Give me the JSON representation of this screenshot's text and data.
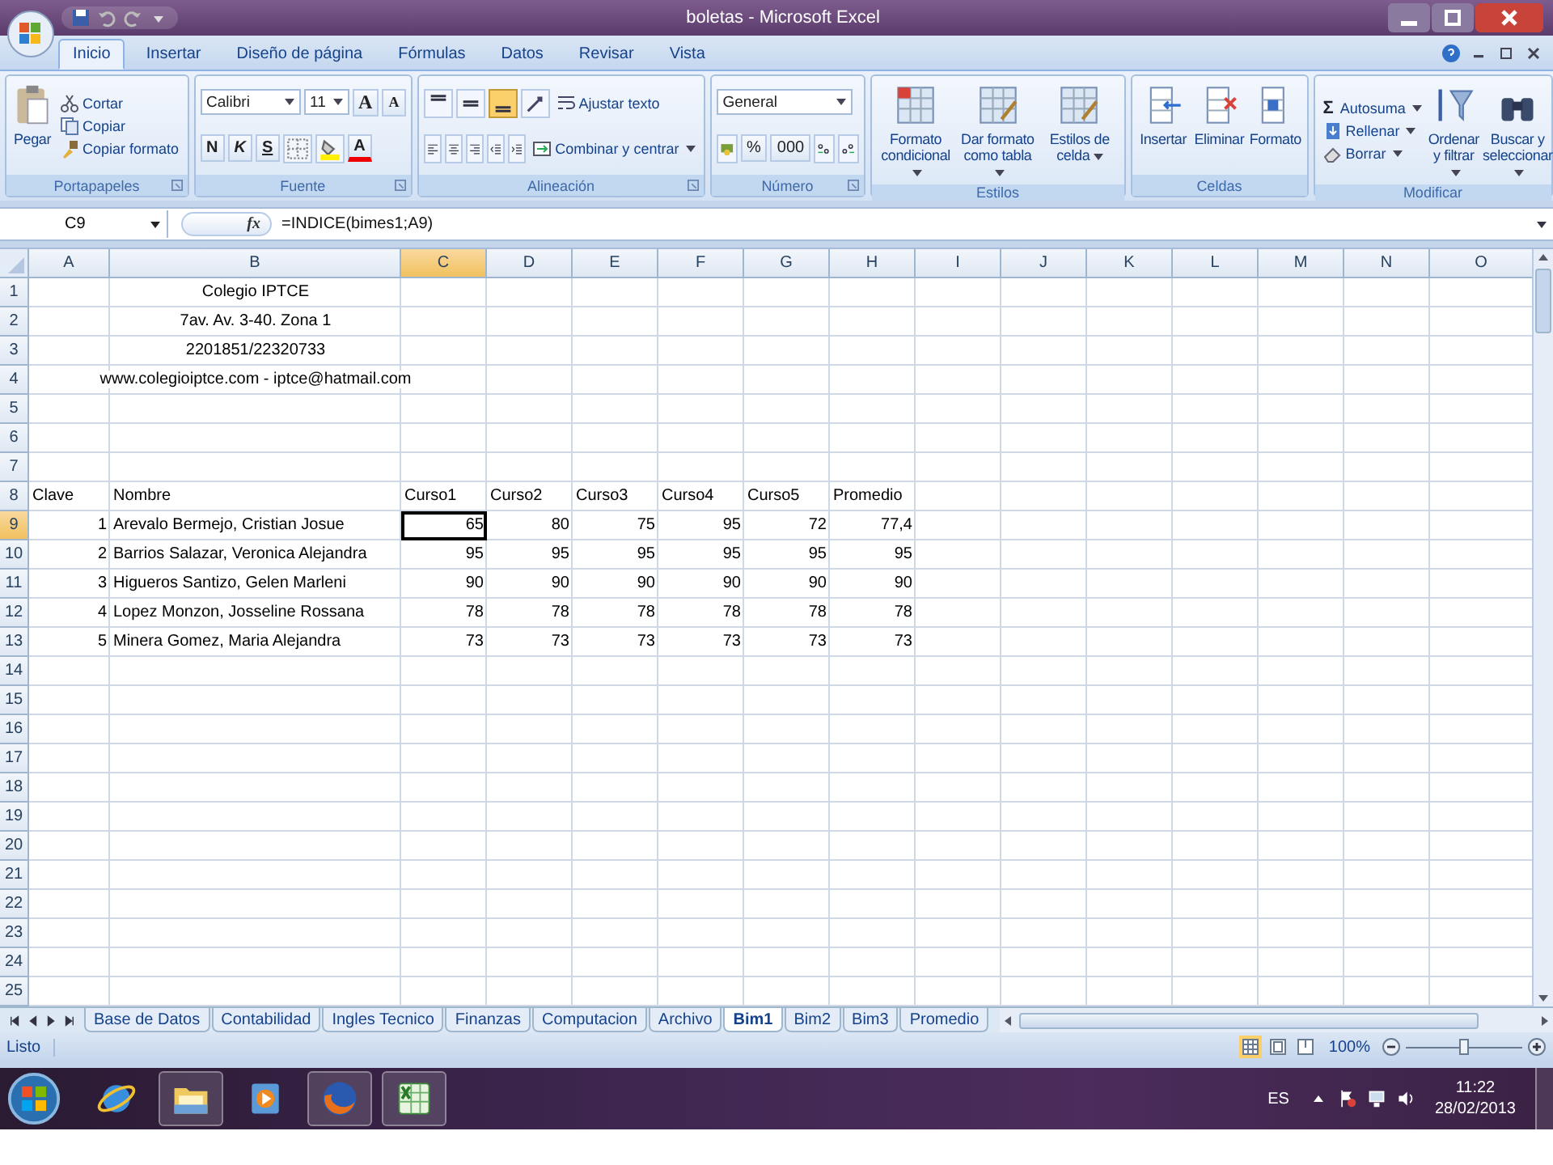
{
  "window": {
    "title": "boletas - Microsoft Excel"
  },
  "ribbon_tabs": [
    {
      "label": "Inicio",
      "selected": true
    },
    {
      "label": "Insertar",
      "selected": false
    },
    {
      "label": "Diseño de página",
      "selected": false
    },
    {
      "label": "Fórmulas",
      "selected": false
    },
    {
      "label": "Datos",
      "selected": false
    },
    {
      "label": "Revisar",
      "selected": false
    },
    {
      "label": "Vista",
      "selected": false
    }
  ],
  "clipboard": {
    "label": "Portapapeles",
    "paste": "Pegar",
    "cut": "Cortar",
    "copy": "Copiar",
    "format_painter": "Copiar formato"
  },
  "font": {
    "label": "Fuente",
    "name": "Calibri",
    "size": "11",
    "grow": "A",
    "shrink": "A",
    "bold": "N",
    "italic": "K",
    "underline": "S",
    "tint_glyph": "A"
  },
  "alignment": {
    "label": "Alineación",
    "vertical_align": [
      {
        "selected": false
      },
      {
        "selected": false
      },
      {
        "selected": true
      }
    ],
    "wrap": "Ajustar texto",
    "merge": "Combinar y centrar"
  },
  "number": {
    "label": "Número",
    "format": "General",
    "percent": "%",
    "thousands": "000"
  },
  "styles": {
    "label": "Estilos",
    "items": [
      "Formato condicional",
      "Dar formato como tabla",
      "Estilos de celda"
    ]
  },
  "cells": {
    "label": "Celdas",
    "items": [
      "Insertar",
      "Eliminar",
      "Formato"
    ]
  },
  "editing": {
    "label": "Modificar",
    "sigma": "Σ",
    "autosum": "Autosuma",
    "fill": "Rellenar",
    "clear": "Borrar",
    "sort": "Ordenar y filtrar",
    "find": "Buscar y seleccionar"
  },
  "formula_bar": {
    "name_box": "C9",
    "fx": "fx",
    "formula": "=INDICE(bimes1;A9)"
  },
  "sheet": {
    "columns": [
      {
        "label": "A",
        "selected": false
      },
      {
        "label": "B",
        "selected": false
      },
      {
        "label": "C",
        "selected": true
      },
      {
        "label": "D",
        "selected": false
      },
      {
        "label": "E",
        "selected": false
      },
      {
        "label": "F",
        "selected": false
      },
      {
        "label": "G",
        "selected": false
      },
      {
        "label": "H",
        "selected": false
      },
      {
        "label": "I",
        "selected": false
      },
      {
        "label": "J",
        "selected": false
      },
      {
        "label": "K",
        "selected": false
      },
      {
        "label": "L",
        "selected": false
      },
      {
        "label": "M",
        "selected": false
      },
      {
        "label": "N",
        "selected": false
      },
      {
        "label": "O",
        "selected": false
      }
    ],
    "rows": [
      {
        "header": "1",
        "selected": false,
        "kind": "title",
        "title": "Colegio IPTCE"
      },
      {
        "header": "2",
        "selected": false,
        "kind": "title",
        "title": "7av. Av. 3-40. Zona 1"
      },
      {
        "header": "3",
        "selected": false,
        "kind": "title",
        "title": "2201851/22320733"
      },
      {
        "header": "4",
        "selected": false,
        "kind": "title",
        "title": "www.colegioiptce.com - iptce@hatmail.com"
      },
      {
        "header": "5",
        "selected": false
      },
      {
        "header": "6",
        "selected": false
      },
      {
        "header": "7",
        "selected": false
      },
      {
        "header": "8",
        "selected": false,
        "kind": "heading",
        "cells": [
          "Clave",
          "Nombre",
          "Curso1",
          "Curso2",
          "Curso3",
          "Curso4",
          "Curso5",
          "Promedio"
        ]
      },
      {
        "header": "9",
        "selected": true,
        "kind": "record",
        "cells": [
          "1",
          "Arevalo Bermejo, Cristian Josue",
          "65",
          "80",
          "75",
          "95",
          "72",
          "77,4"
        ]
      },
      {
        "header": "10",
        "selected": false,
        "kind": "record",
        "cells": [
          "2",
          "Barrios Salazar, Veronica Alejandra",
          "95",
          "95",
          "95",
          "95",
          "95",
          "95"
        ]
      },
      {
        "header": "11",
        "selected": false,
        "kind": "record",
        "cells": [
          "3",
          "Higueros Santizo, Gelen Marleni",
          "90",
          "90",
          "90",
          "90",
          "90",
          "90"
        ]
      },
      {
        "header": "12",
        "selected": false,
        "kind": "record",
        "cells": [
          "4",
          "Lopez Monzon, Josseline Rossana",
          "78",
          "78",
          "78",
          "78",
          "78",
          "78"
        ]
      },
      {
        "header": "13",
        "selected": false,
        "kind": "record",
        "cells": [
          "5",
          "Minera Gomez, Maria Alejandra",
          "73",
          "73",
          "73",
          "73",
          "73",
          "73"
        ]
      },
      {
        "header": "14",
        "selected": false
      },
      {
        "header": "15",
        "selected": false
      },
      {
        "header": "16",
        "selected": false
      },
      {
        "header": "17",
        "selected": false
      },
      {
        "header": "18",
        "selected": false
      },
      {
        "header": "19",
        "selected": false
      },
      {
        "header": "20",
        "selected": false
      },
      {
        "header": "21",
        "selected": false
      },
      {
        "header": "22",
        "selected": false
      },
      {
        "header": "23",
        "selected": false
      },
      {
        "header": "24",
        "selected": false
      },
      {
        "header": "25",
        "selected": false
      }
    ]
  },
  "sheet_tabs": [
    {
      "label": "Base de Datos",
      "selected": false
    },
    {
      "label": "Contabilidad",
      "selected": false
    },
    {
      "label": "Ingles Tecnico",
      "selected": false
    },
    {
      "label": "Finanzas",
      "selected": false
    },
    {
      "label": "Computacion",
      "selected": false
    },
    {
      "label": "Archivo",
      "selected": false
    },
    {
      "label": "Bim1",
      "selected": true
    },
    {
      "label": "Bim2",
      "selected": false
    },
    {
      "label": "Bim3",
      "selected": false
    },
    {
      "label": "Promedio",
      "selected": false
    }
  ],
  "status_bar": {
    "status": "Listo",
    "views": [
      {
        "selected": true
      },
      {
        "selected": false
      },
      {
        "selected": false
      }
    ],
    "zoom": "100%",
    "zoom_slider": {
      "level": 0.5
    }
  },
  "taskbar": {
    "apps": [
      {
        "running": false
      },
      {
        "running": true
      },
      {
        "running": false
      },
      {
        "running": true
      },
      {
        "running": true
      }
    ],
    "language": "ES",
    "time": "11:22",
    "date": "28/02/2013"
  }
}
